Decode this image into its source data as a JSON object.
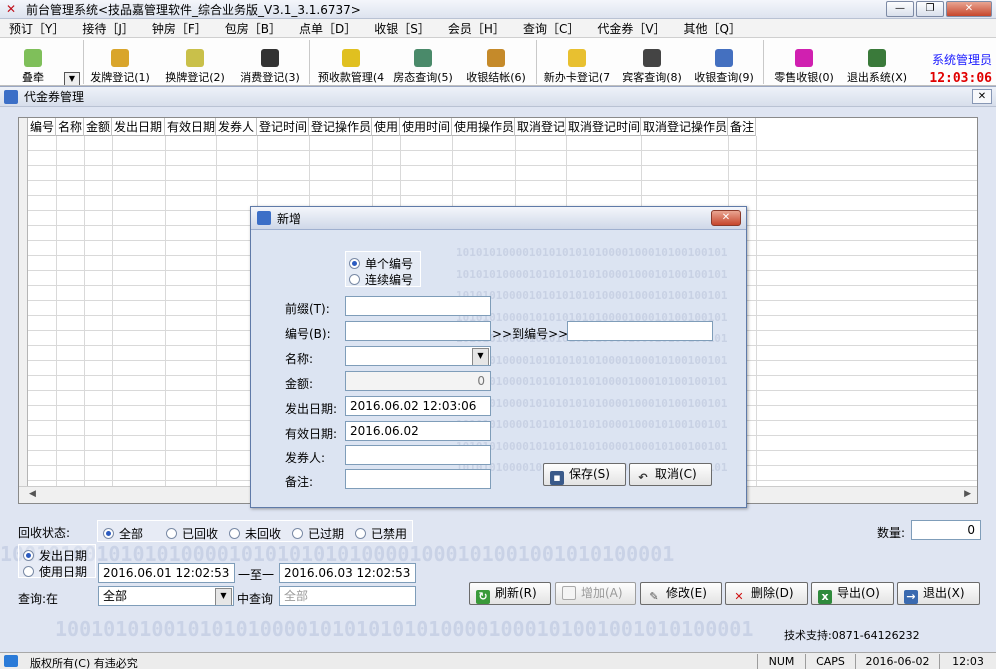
{
  "window": {
    "title": "前台管理系统<技品嘉管理软件_综合业务版_V3.1_3.1.6737>",
    "app_icon": "蓝",
    "min": "—",
    "max": "❐",
    "close": "✕"
  },
  "menu": [
    "预订［Y］",
    "接待［J］",
    "钟房［F］",
    "包房［B］",
    "点单［D］",
    "收银［S］",
    "会员［H］",
    "查询［C］",
    "代金券［V］",
    "其他［Q］"
  ],
  "toolbar": {
    "items": [
      "叠牵",
      "发牌登记(1)",
      "换牌登记(2)",
      "消费登记(3)",
      "预收款管理(4",
      "房态查询(5)",
      "收银结帐(6)",
      "新办卡登记(7",
      "宾客查询(8)",
      "收银查询(9)",
      "零售收银(0)",
      "退出系统(X)"
    ],
    "user": "系统管理员",
    "clock": "12:03:06"
  },
  "main": {
    "title": "代金券管理",
    "close": "✕",
    "columns": [
      "编号",
      "名称",
      "金额",
      "发出日期",
      "有效日期",
      "发券人",
      "登记时间",
      "登记操作员",
      "使用",
      "使用时间",
      "使用操作员",
      "取消登记",
      "取消登记时间",
      "取消登记操作员",
      "备注"
    ],
    "bg_bits": "1001010100101010100001010101010100001000101001001010100001",
    "bg_bits2": "010100101010100001010101010100001000101001001010100001",
    "bg_bits3": "10010100101010100001010101010100001000101001001010100001"
  },
  "filter": {
    "recycle_label": "回收状态:",
    "recycle_options": [
      "全部",
      "已回收",
      "未回收",
      "已过期",
      "已禁用"
    ],
    "recycle_selected": 0,
    "date_options": [
      "发出日期",
      "使用日期"
    ],
    "date_selected": 0,
    "date_from": "2016.06.01 12:02:53",
    "date_to_label": "一至一",
    "date_to": "2016.06.03 12:02:53",
    "query_label": "查询:在",
    "query_scope": "全部",
    "mid_query_label": "中查询",
    "query_placeholder": "全部",
    "count_label": "数量:",
    "count_value": "0"
  },
  "buttons": {
    "refresh": "刷新(R)",
    "add": "增加(A)",
    "edit": "修改(E)",
    "delete": "删除(D)",
    "export": "导出(O)",
    "exit": "退出(X)"
  },
  "support": "技术支持:0871-64126232",
  "status": {
    "copyright": "版权所有(C) 有违必究",
    "num": "NUM",
    "caps": "CAPS",
    "date": "2016-06-02",
    "time": "12:03"
  },
  "dialog": {
    "title": "新增",
    "mode_options": [
      "单个编号",
      "连续编号"
    ],
    "mode_selected": 0,
    "prefix_label": "前缀(T):",
    "number_label": "编号(B):",
    "to_number_label": ">>到编号>>>",
    "name_label": "名称:",
    "amount_label": "金额:",
    "amount_value": "0",
    "issue_date_label": "发出日期:",
    "issue_date_value": "2016.06.02 12:03:06",
    "valid_date_label": "有效日期:",
    "valid_date_value": "2016.06.02",
    "issuer_label": "发券人:",
    "remark_label": "备注:",
    "save": "保存(S)",
    "cancel": "取消(C)",
    "bg_bits": "10101010000101010101010000100010100100101"
  }
}
